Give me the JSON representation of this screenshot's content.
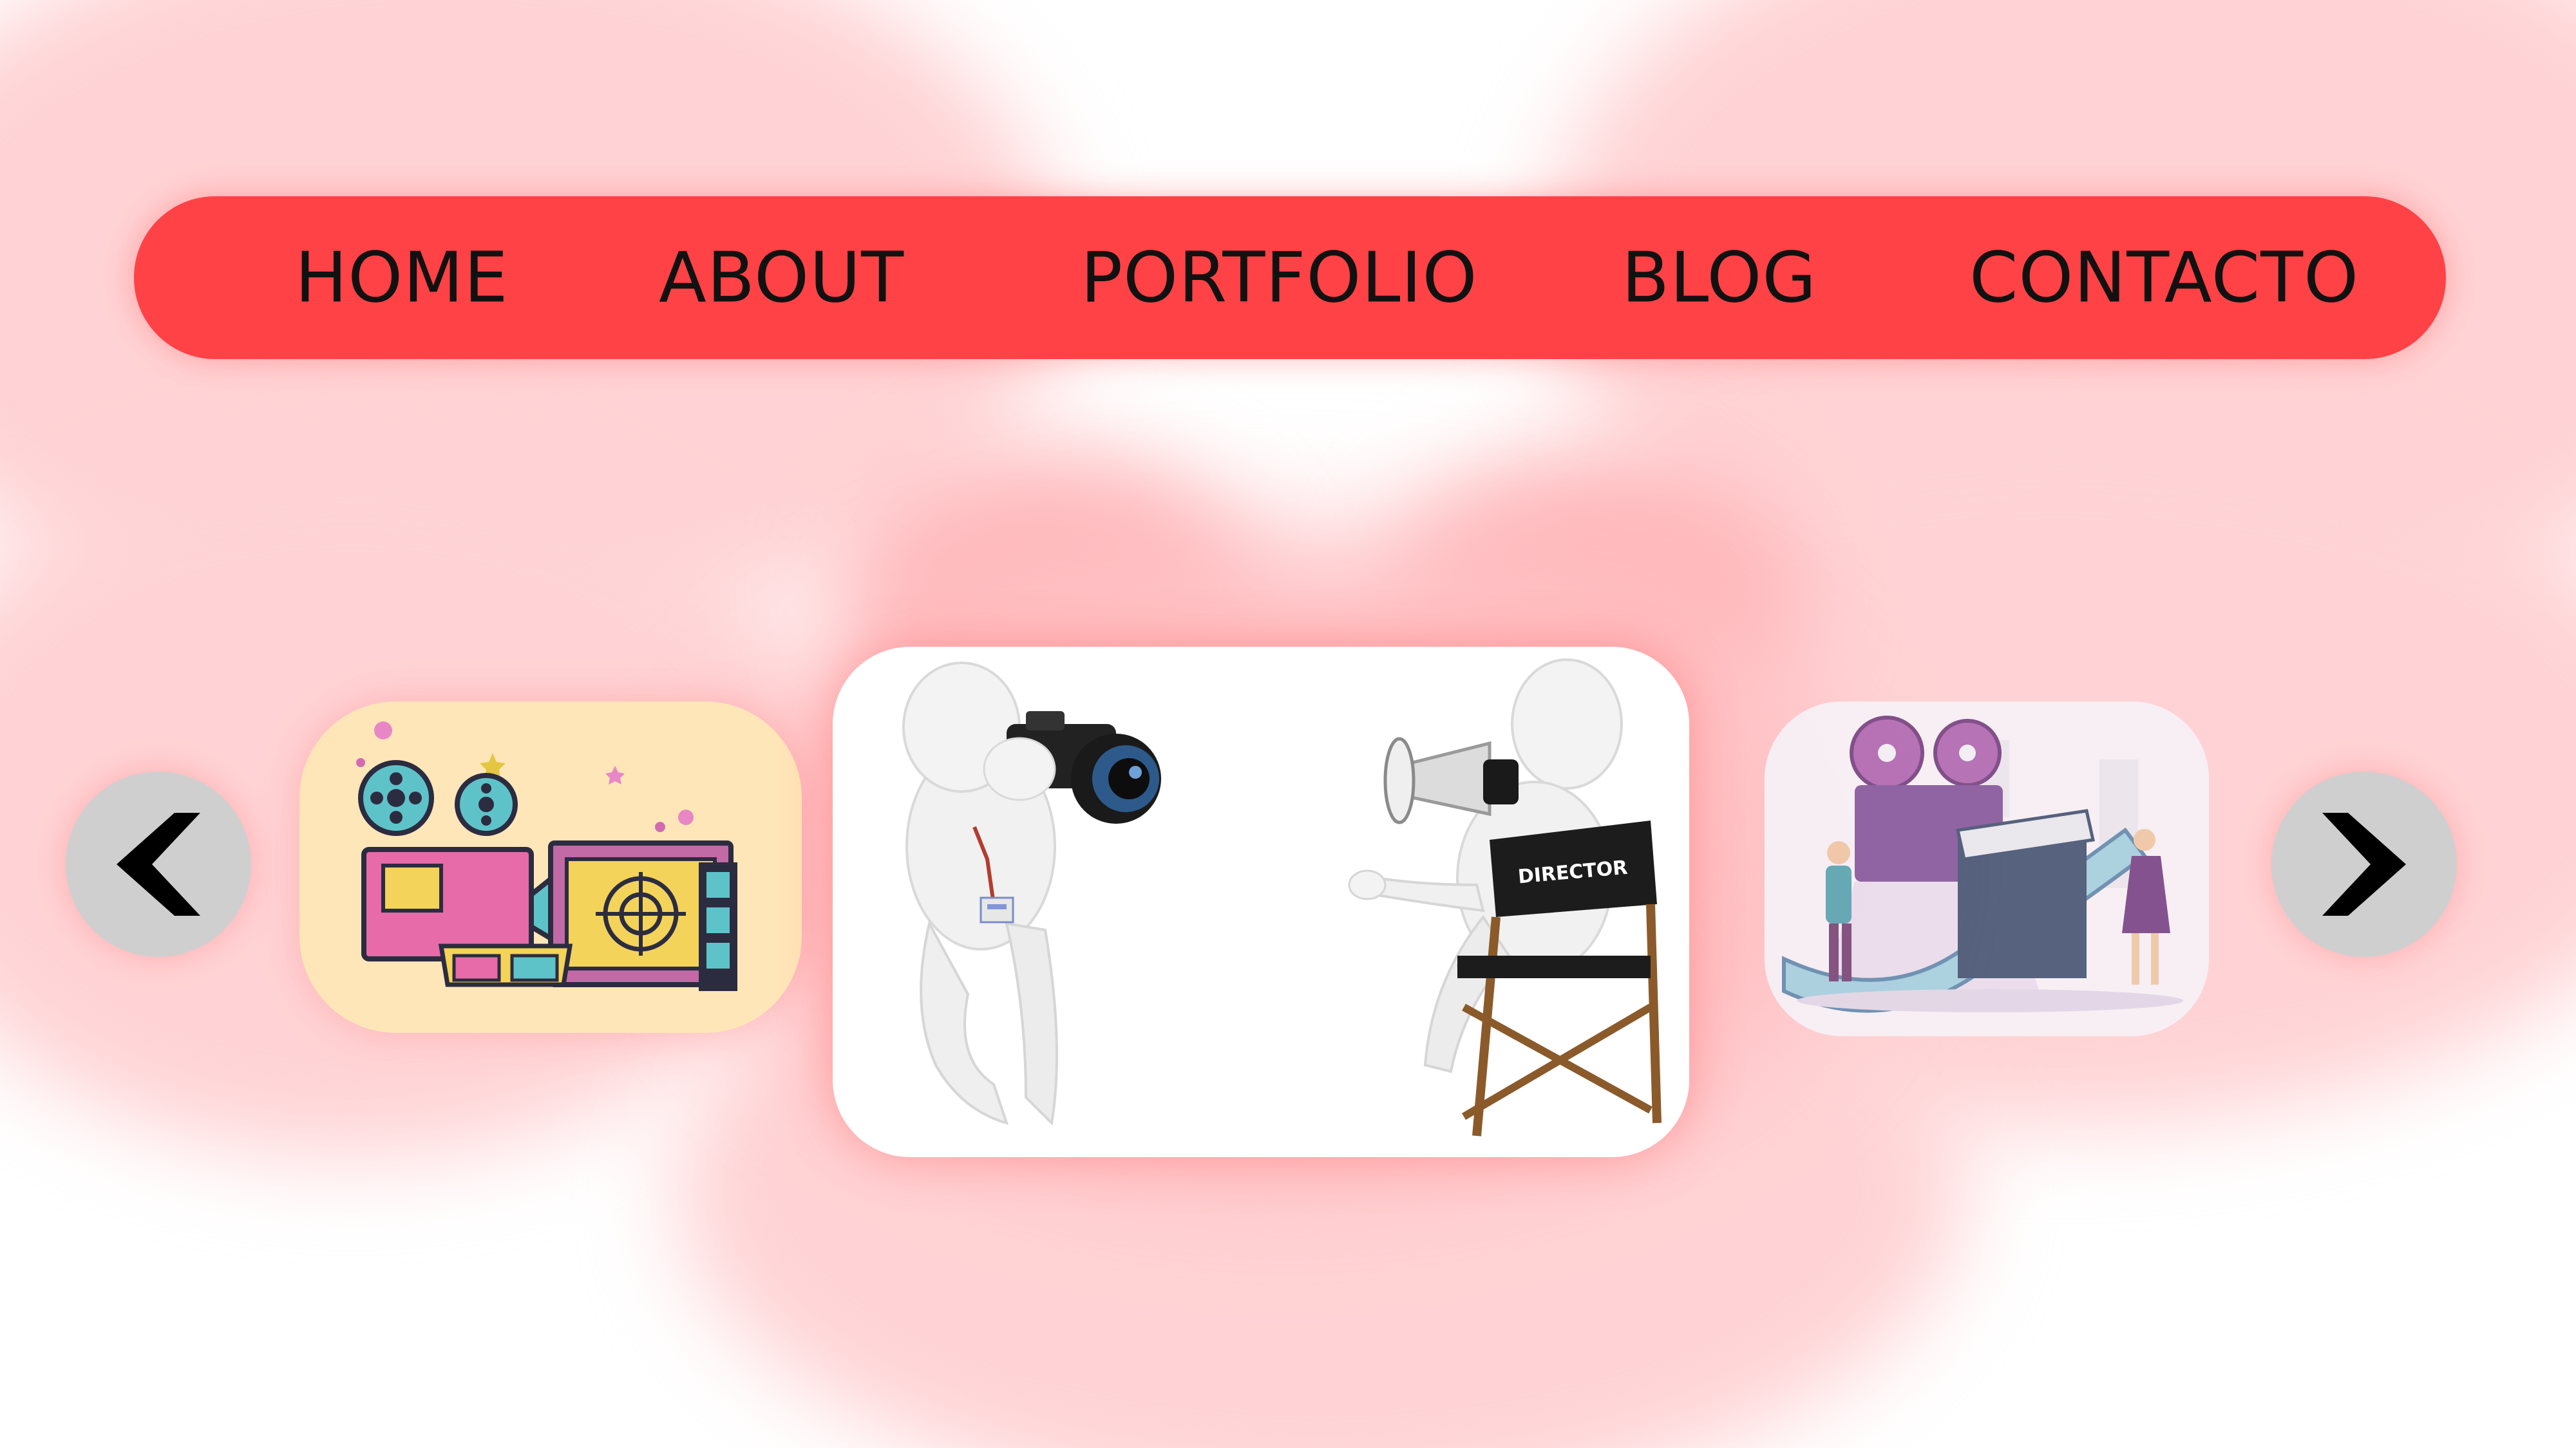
{
  "nav": {
    "items": [
      {
        "label": "HOME"
      },
      {
        "label": "ABOUT"
      },
      {
        "label": "PORTFOLIO"
      },
      {
        "label": "BLOG"
      },
      {
        "label": "CONTACTO"
      }
    ]
  },
  "carousel": {
    "prev_icon": "chevron-left-icon",
    "next_icon": "chevron-right-icon",
    "center_chair_label": "DIRECTOR"
  },
  "colors": {
    "nav_background": "#ff4246",
    "nav_text": "#111111",
    "glow": "#ffd3d5",
    "arrow_background": "#cfcfcf"
  }
}
